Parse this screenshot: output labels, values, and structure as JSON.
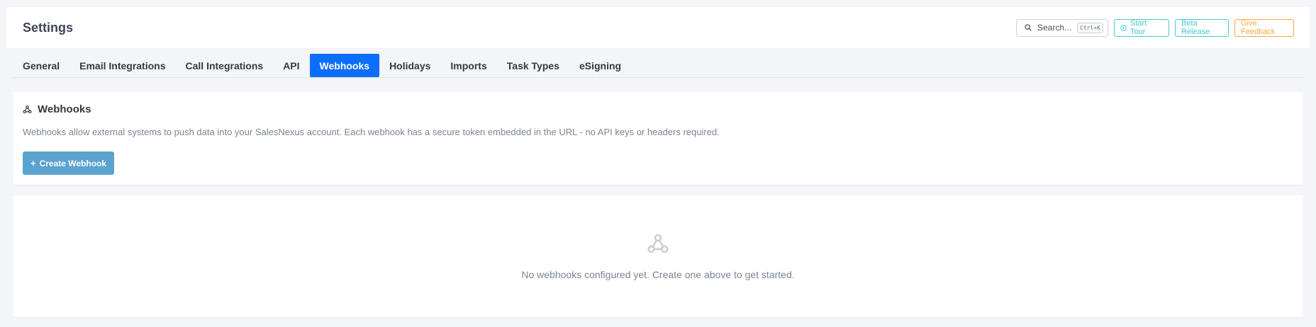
{
  "header": {
    "title": "Settings",
    "search": {
      "label": "Search...",
      "shortcut": "Ctrl+K",
      "icon": "search-icon"
    },
    "actions": {
      "start_tour": "Start Tour",
      "beta_release": "Beta Release",
      "give_feedback": "Give Feedback"
    }
  },
  "tabs": [
    {
      "label": "General",
      "active": false
    },
    {
      "label": "Email Integrations",
      "active": false
    },
    {
      "label": "Call Integrations",
      "active": false
    },
    {
      "label": "API",
      "active": false
    },
    {
      "label": "Webhooks",
      "active": true
    },
    {
      "label": "Holidays",
      "active": false
    },
    {
      "label": "Imports",
      "active": false
    },
    {
      "label": "Task Types",
      "active": false
    },
    {
      "label": "eSigning",
      "active": false
    }
  ],
  "webhooks": {
    "title": "Webhooks",
    "description": "Webhooks allow external systems to push data into your SalesNexus account. Each webhook has a secure token embedded in the URL - no API keys or headers required.",
    "create_button": "Create Webhook"
  },
  "empty_state": {
    "message": "No webhooks configured yet. Create one above to get started.",
    "icon": "webhook-icon"
  },
  "colors": {
    "accent": "#0d6efd",
    "create_button": "#5aa3cf",
    "teal": "#3ec9d6",
    "orange": "#f7a93b"
  }
}
